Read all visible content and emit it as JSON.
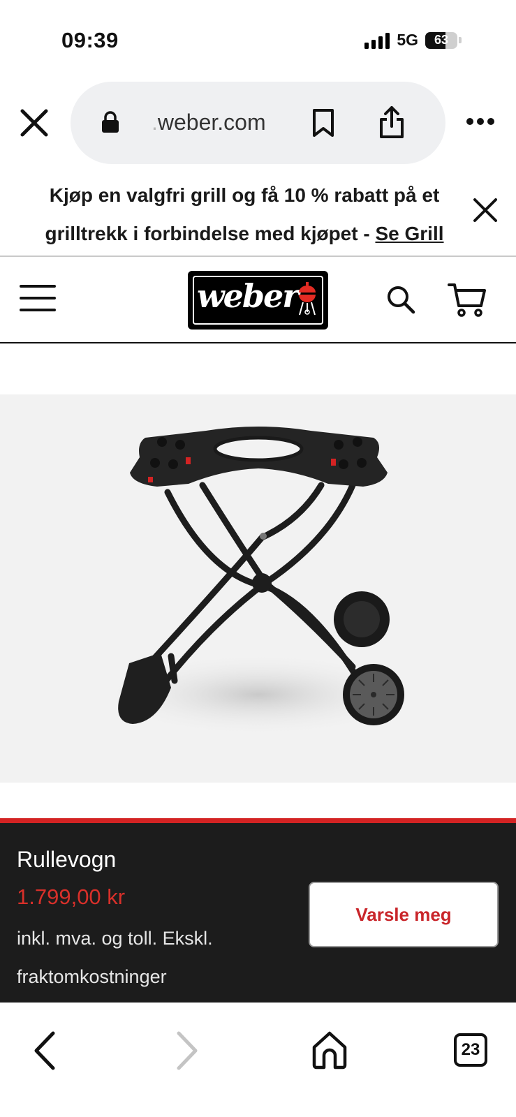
{
  "status_bar": {
    "time": "09:39",
    "network": "5G",
    "battery_level": "63",
    "battery_fraction": 0.63
  },
  "browser": {
    "url_faded": ".",
    "url": "weber.com",
    "icons": [
      "close-icon",
      "lock-icon",
      "bookmark-icon",
      "share-icon",
      "more-icon"
    ]
  },
  "promo": {
    "text": "Kjøp en valgfri grill og få 10 % rabatt på et grilltrekk i forbindelse med kjøpet - ",
    "link": "Se Grill"
  },
  "header": {
    "logo_text": "weber",
    "icons": [
      "menu-icon",
      "search-icon",
      "cart-icon"
    ]
  },
  "product": {
    "name": "Rullevogn",
    "price": "1.799,00 kr",
    "price_note": "inkl. mva. og toll. Ekskl. fraktomkostninger",
    "notify_button": "Varsle meg"
  },
  "toolbar": {
    "tabs_count": "23",
    "icons": [
      "back-icon",
      "forward-icon",
      "home-icon",
      "tabs-icon"
    ]
  },
  "colors": {
    "accent_red": "#d32323",
    "price_red": "#d8302a",
    "bar_dark": "#1c1c1c",
    "url_pill": "#eff0f2"
  }
}
